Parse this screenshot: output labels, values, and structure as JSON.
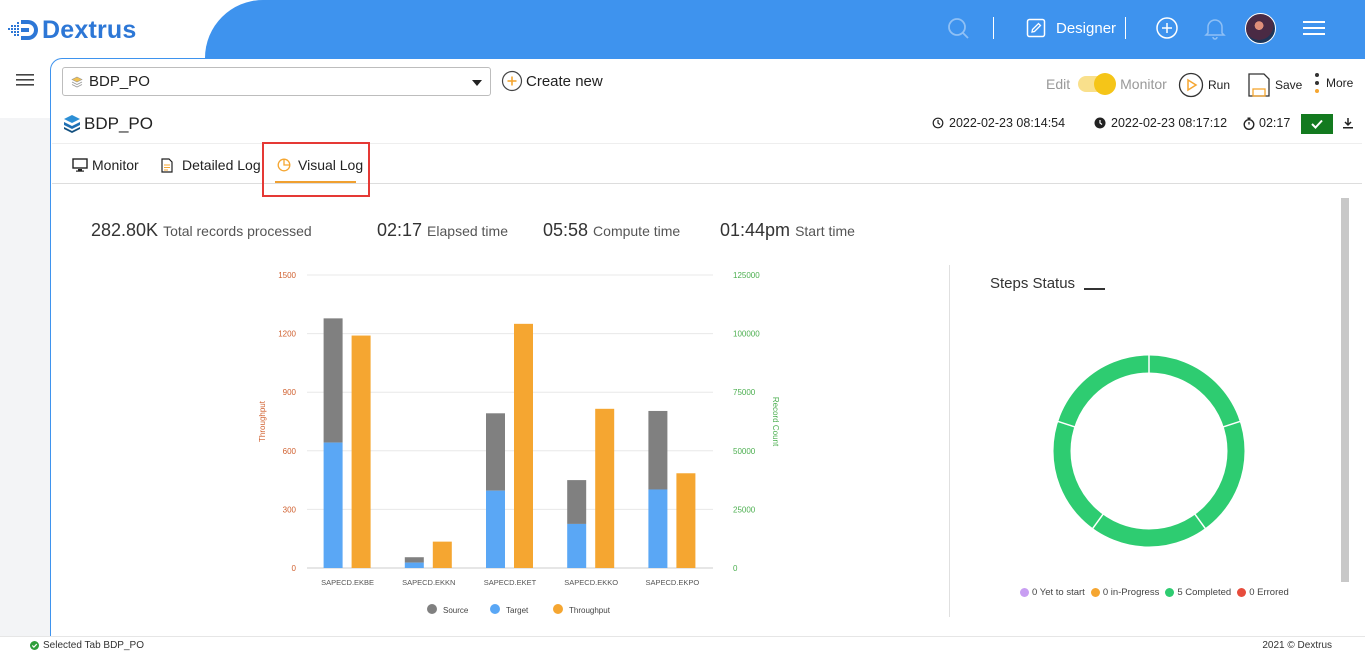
{
  "header": {
    "logo_text": "Dextrus",
    "designer_label": "Designer"
  },
  "toolbar": {
    "selected_job": "BDP_PO",
    "create_new_label": "Create new",
    "edit_label": "Edit",
    "monitor_label": "Monitor",
    "run_label": "Run",
    "save_label": "Save",
    "more_label": "More"
  },
  "job": {
    "name": "BDP_PO",
    "start_time": "2022-02-23 08:14:54",
    "end_time": "2022-02-23 08:17:12",
    "duration": "02:17"
  },
  "tabs": [
    {
      "label": "Monitor"
    },
    {
      "label": "Detailed Log"
    },
    {
      "label": "Visual Log",
      "active": true
    }
  ],
  "stats": [
    {
      "value": "282.80K",
      "label": "Total records processed"
    },
    {
      "value": "02:17",
      "label": "Elapsed time"
    },
    {
      "value": "05:58",
      "label": "Compute time"
    },
    {
      "value": "01:44pm",
      "label": "Start time"
    }
  ],
  "colors": {
    "header_blue": "#3e93ee",
    "source": "#808080",
    "target": "#5aa7f5",
    "throughput": "#f5a631",
    "completed": "#2ecc71",
    "yet_to_start": "#c89ef2",
    "in_progress": "#f5a631",
    "errored": "#e74c3c",
    "left_axis": "#d0602f",
    "right_axis": "#4caf50"
  },
  "chart_data": [
    {
      "type": "bar",
      "categories": [
        "SAPECD.EKBE",
        "SAPECD.EKKN",
        "SAPECD.EKET",
        "SAPECD.EKKO",
        "SAPECD.EKPO"
      ],
      "series": [
        {
          "name": "Source",
          "axis": "right",
          "stack": "records",
          "values": [
            106500,
            4600,
            66000,
            37500,
            67000
          ]
        },
        {
          "name": "Target",
          "axis": "right",
          "stack": "records",
          "values": [
            53500,
            2300,
            33000,
            18800,
            33500
          ]
        },
        {
          "name": "Throughput",
          "axis": "left",
          "values": [
            1190,
            135,
            1250,
            815,
            485
          ]
        }
      ],
      "ylabel": "Throughput",
      "y2label": "Record Count",
      "ylim": [
        0,
        1500
      ],
      "y2lim": [
        0,
        125000
      ],
      "yticks": [
        "0",
        "300",
        "600",
        "900",
        "1200",
        "1500"
      ],
      "y2ticks": [
        "0",
        "25000",
        "50000",
        "75000",
        "100000",
        "125000"
      ],
      "legend_position": "bottom",
      "grid": true
    },
    {
      "type": "pie",
      "title": "Steps Status",
      "categories": [
        "Yet to start",
        "in-Progress",
        "Completed",
        "Errored"
      ],
      "values": [
        0,
        0,
        5,
        0
      ],
      "legend": [
        "0 Yet to start",
        "0 in-Progress",
        "5 Completed",
        "0 Errored"
      ],
      "legend_position": "bottom"
    }
  ],
  "footer": {
    "status": "Selected Tab BDP_PO",
    "copyright": "2021 © Dextrus"
  }
}
